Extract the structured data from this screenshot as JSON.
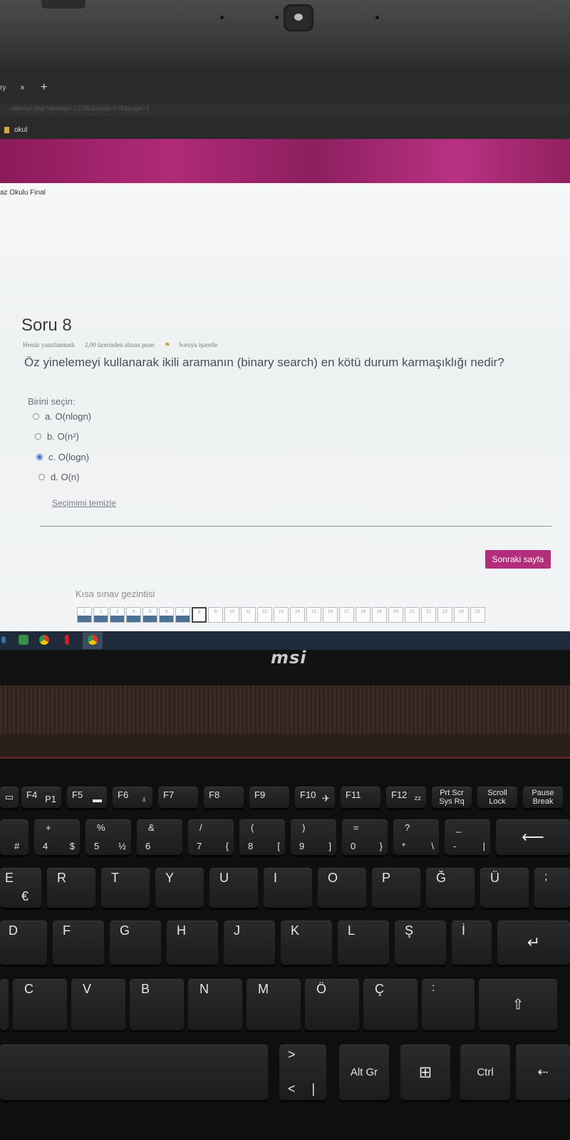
{
  "browser": {
    "tab_title": "ry",
    "tab_close": "×",
    "new_tab": "+",
    "url": "...attempt.php?attempt=12345&cmid=678&page=1",
    "bookmark": "okul"
  },
  "page": {
    "course_name": "az Okulu Final",
    "question": {
      "title": "Soru 8",
      "status": "Henüz yanıtlanmadı",
      "points": "2,00 üzerinden alınan puan",
      "flag_label": "Soruyu işaretle",
      "text": "Öz yinelemeyi kullanarak ikili aramanın (binary search) en kötü durum karmaşıklığı nedir?",
      "prompt": "Birini seçin:",
      "options": [
        {
          "label": "a. O(nlogn)",
          "selected": false
        },
        {
          "label": "b. O(n²)",
          "selected": false
        },
        {
          "label": "c. O(logn)",
          "selected": true
        },
        {
          "label": "d. O(n)",
          "selected": false
        }
      ],
      "clear_label": "Seçimimi temizle"
    },
    "next_button": "Sonraki sayfa",
    "quiz_nav": {
      "title": "Kısa sınav gezintisi",
      "items": [
        "1",
        "2",
        "3",
        "4",
        "5",
        "6",
        "7",
        "8",
        "9",
        "10",
        "11",
        "12",
        "13",
        "14",
        "15",
        "16",
        "17",
        "18",
        "19",
        "20",
        "21",
        "22",
        "23",
        "24",
        "25"
      ],
      "answered_count": 7,
      "current": "8"
    }
  },
  "laptop": {
    "brand": "msi"
  },
  "keyboard": {
    "f4": "F4",
    "f4_sub": "P1",
    "f5": "F5",
    "f6": "F6",
    "f7": "F7",
    "f8": "F8",
    "f9": "F9",
    "f10": "F10",
    "f11": "F11",
    "f12": "F12",
    "prtsc": "Prt Scr\nSys Rq",
    "scroll": "Scroll\nLock",
    "pause": "Pause\nBreak",
    "k4": "4",
    "k4_top": "+",
    "k4_sub": "$",
    "k5": "5",
    "k5_top": "%",
    "k5_sub": "½",
    "k6": "6",
    "k6_top": "&",
    "k7": "7",
    "k7_top": "/",
    "k7_sub": "{",
    "k8": "8",
    "k8_top": "(",
    "k8_sub": "[",
    "k9": "9",
    "k9_top": ")",
    "k9_sub": "]",
    "k0": "0",
    "k0_top": "=",
    "k0_sub": "}",
    "kstar": "*",
    "kstar_top": "?",
    "kstar_sub": "\\",
    "kminus": "-",
    "kminus_top": "_",
    "kminus_sub": "|",
    "hash": "#",
    "e": "E",
    "e_sub": "€",
    "r": "R",
    "t": "T",
    "y": "Y",
    "u": "U",
    "i": "I",
    "o": "O",
    "p": "P",
    "gbreve": "Ğ",
    "uuml": "Ü",
    "d": "D",
    "f": "F",
    "g": "G",
    "h": "H",
    "j": "J",
    "k": "K",
    "l": "L",
    "scedil": "Ş",
    "idot": "İ",
    "c": "C",
    "v": "V",
    "b": "B",
    "n": "N",
    "m": "M",
    "ouml": "Ö",
    "ccedil": "Ç",
    "colon": ":",
    "semicolon": ";",
    "ltgt_top": ">",
    "ltgt": "<",
    "ltgt_sub": "|",
    "altgr": "Alt Gr",
    "ctrl": "Ctrl"
  }
}
